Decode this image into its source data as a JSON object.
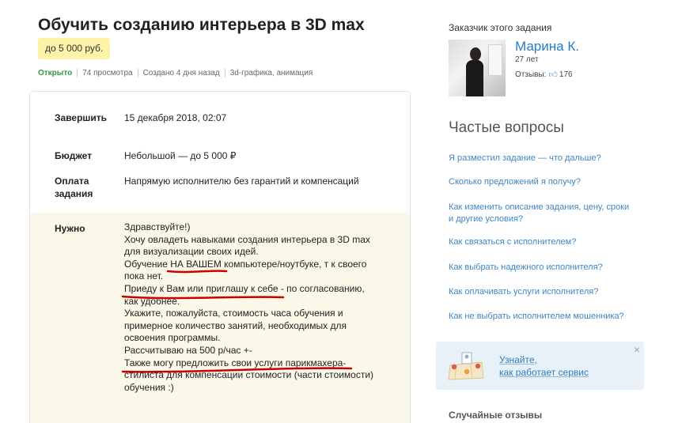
{
  "task": {
    "title": "Обучить созданию интерьера в 3D max",
    "price": "до 5 000 руб.",
    "meta": {
      "status": "Открыто",
      "views": "74 просмотра",
      "created": "Создано 4 дня назад",
      "categories": "3d-графика, анимация"
    },
    "details": {
      "finish_label": "Завершить",
      "finish_value": "15 декабря 2018, 02:07",
      "budget_label": "Бюджет",
      "budget_value": "Небольшой — до 5 000 ₽",
      "payment_label_1": "Оплата",
      "payment_label_2": "задания",
      "payment_value": "Напрямую исполнителю без гарантий и компенсаций",
      "need_label": "Нужно",
      "need_lines": [
        "Здравствуйте!)",
        "Хочу овладеть навыками создания интерьера в 3D max",
        "для визуализации своих идей.",
        "Обучение НА ВАШЕМ компьютере/ноутбуке, т к своего",
        "пока нет.",
        "Приеду к Вам или приглашу к себе - по согласованию,",
        "как удобнее.",
        "Укажите, пожалуйста, стоимость часа обучения и",
        "примерное количество занятий, необходимых для",
        "освоения программы.",
        "Рассчитываю на 500 р/час +-",
        "Также могу предложить свои услуги парикмахера-",
        "стилиста для компенсации стоимости (части стоимости)",
        "обучения :)"
      ]
    }
  },
  "sidebar": {
    "customer_heading": "Заказчик этого задания",
    "customer": {
      "name": "Марина К.",
      "age": "27 лет",
      "reviews_label": "Отзывы:",
      "reviews_count": "176"
    },
    "faq_title": "Частые вопросы",
    "faq": [
      "Я разместил задание — что дальше?",
      "Сколько предложений я получу?",
      "Как изменить описание задания, цену, сроки",
      "и другие условия?",
      "Как связаться с исполнителем?",
      "Как выбрать надежного исполнителя?",
      "Как оплачивать услуги исполнителя?",
      "Как не выбрать исполнителем мошенника?"
    ],
    "learn_line_1": "Узнайте,",
    "learn_line_2": "как работает сервис",
    "close_symbol": "×",
    "random_reviews": "Случайные отзывы"
  },
  "icons": {
    "thumb": "thumb-up-icon",
    "map": "map-pins-icon",
    "close": "close-icon"
  },
  "colors": {
    "link": "#3d86c6",
    "status_open": "#3a9a3a",
    "price_badge": "#fdf3a8",
    "need_background": "#fbf8e9",
    "annotation": "#cc0000"
  }
}
